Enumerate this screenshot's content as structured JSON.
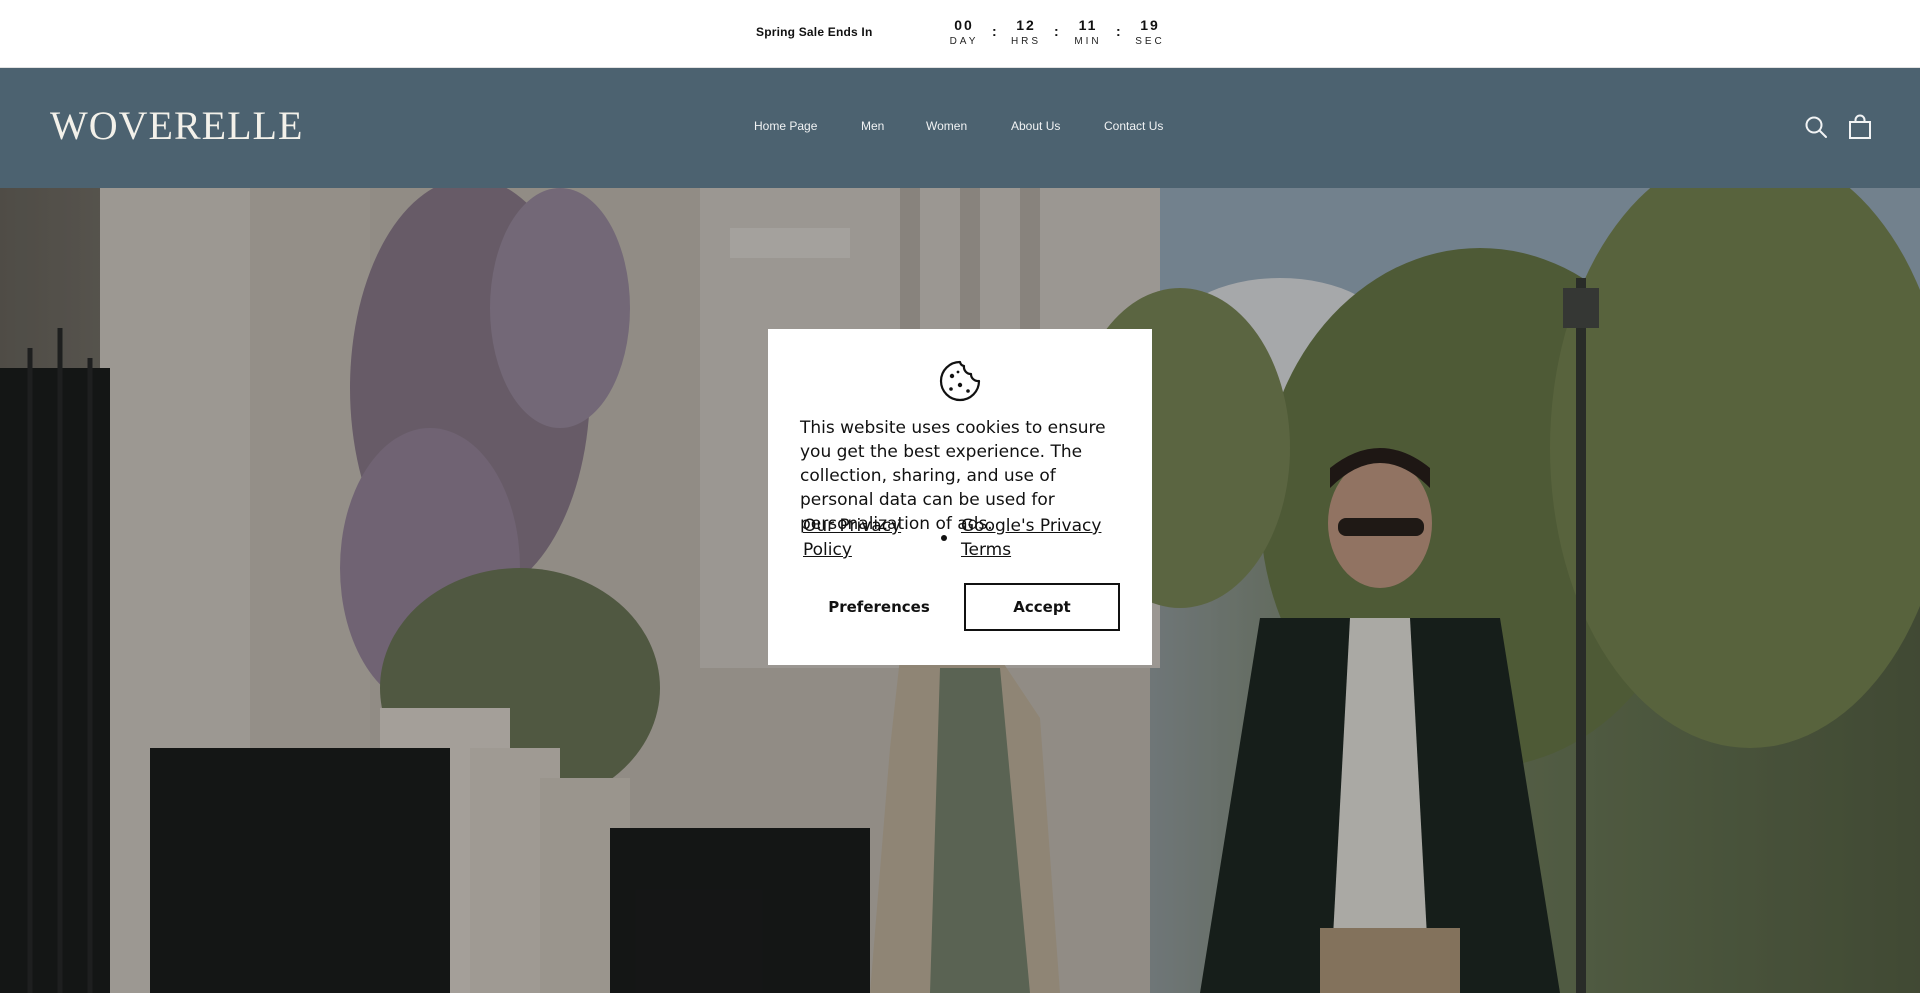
{
  "announcement": {
    "text": "Spring Sale Ends In",
    "countdown": [
      {
        "value": "00",
        "label": "DAY"
      },
      {
        "value": "12",
        "label": "HRS"
      },
      {
        "value": "11",
        "label": "MIN"
      },
      {
        "value": "19",
        "label": "SEC"
      }
    ],
    "separator": ":"
  },
  "header": {
    "logo": "WOVERELLE",
    "nav": [
      "Home Page",
      "Men",
      "Women",
      "About Us",
      "Contact Us"
    ],
    "icons": [
      "search-icon",
      "shopping-bag-icon"
    ],
    "background_color": "#4c6270"
  },
  "cookie_banner": {
    "icon": "cookie-icon",
    "message": "This website uses cookies to ensure you get the best experience. The collection, sharing, and use of personal data can be used for personalization of ads.",
    "links": [
      "Our Privacy Policy",
      "Google's Privacy Terms"
    ],
    "preferences_label": "Preferences",
    "accept_label": "Accept"
  },
  "hero": {
    "image": "couple-walking-street-photo"
  }
}
